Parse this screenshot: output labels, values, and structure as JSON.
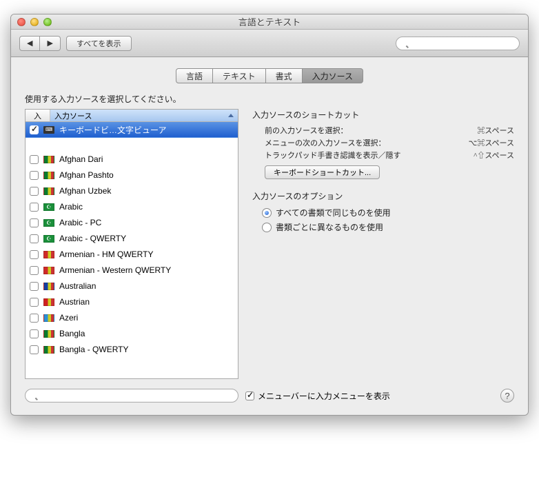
{
  "window": {
    "title": "言語とテキスト"
  },
  "toolbar": {
    "showAll": "すべてを表示"
  },
  "tabs": [
    {
      "label": "言語"
    },
    {
      "label": "テキスト"
    },
    {
      "label": "書式"
    },
    {
      "label": "入力ソース",
      "active": true
    }
  ],
  "instruction": "使用する入力ソースを選択してください。",
  "listHeader": {
    "col1": "入",
    "col2": "入力ソース"
  },
  "sources": [
    {
      "checked": true,
      "flagColor": "#333",
      "label": "キーボードビ…文字ビューア",
      "selected": true,
      "iconKind": "kb"
    },
    {
      "blank": true
    },
    {
      "checked": false,
      "flagColor": "#0a7a2f",
      "label": "Afghan Dari"
    },
    {
      "checked": false,
      "flagColor": "#0a7a2f",
      "label": "Afghan Pashto"
    },
    {
      "checked": false,
      "flagColor": "#0a7a2f",
      "label": "Afghan Uzbek"
    },
    {
      "checked": false,
      "flagColor": "#1a8f3a",
      "label": "Arabic",
      "iconKind": "cres"
    },
    {
      "checked": false,
      "flagColor": "#1a8f3a",
      "label": "Arabic - PC",
      "iconKind": "cres"
    },
    {
      "checked": false,
      "flagColor": "#1a8f3a",
      "label": "Arabic - QWERTY",
      "iconKind": "cres"
    },
    {
      "checked": false,
      "flagColor": "#cf2a2a",
      "label": "Armenian - HM QWERTY"
    },
    {
      "checked": false,
      "flagColor": "#cf2a2a",
      "label": "Armenian - Western QWERTY"
    },
    {
      "checked": false,
      "flagColor": "#1440a3",
      "label": "Australian"
    },
    {
      "checked": false,
      "flagColor": "#d02020",
      "label": "Austrian"
    },
    {
      "checked": false,
      "flagColor": "#2a90d6",
      "label": "Azeri"
    },
    {
      "checked": false,
      "flagColor": "#0a7a2f",
      "label": "Bangla"
    },
    {
      "checked": false,
      "flagColor": "#0a7a2f",
      "label": "Bangla - QWERTY"
    }
  ],
  "shortcuts": {
    "title": "入力ソースのショートカット",
    "rows": [
      {
        "label": "前の入力ソースを選択：",
        "shortcut": "⌘スペース"
      },
      {
        "label": "メニューの次の入力ソースを選択：",
        "shortcut": "⌥⌘スペース"
      },
      {
        "label": "トラックパッド手書き認識を表示／隠す",
        "shortcut": "^⇧スペース"
      }
    ],
    "buttonLabel": "キーボードショートカット..."
  },
  "options": {
    "title": "入力ソースのオプション",
    "radios": [
      {
        "label": "すべての書類で同じものを使用",
        "selected": true
      },
      {
        "label": "書類ごとに異なるものを使用",
        "selected": false
      }
    ]
  },
  "footer": {
    "checkboxLabel": "メニューバーに入力メニューを表示",
    "help": "?"
  }
}
